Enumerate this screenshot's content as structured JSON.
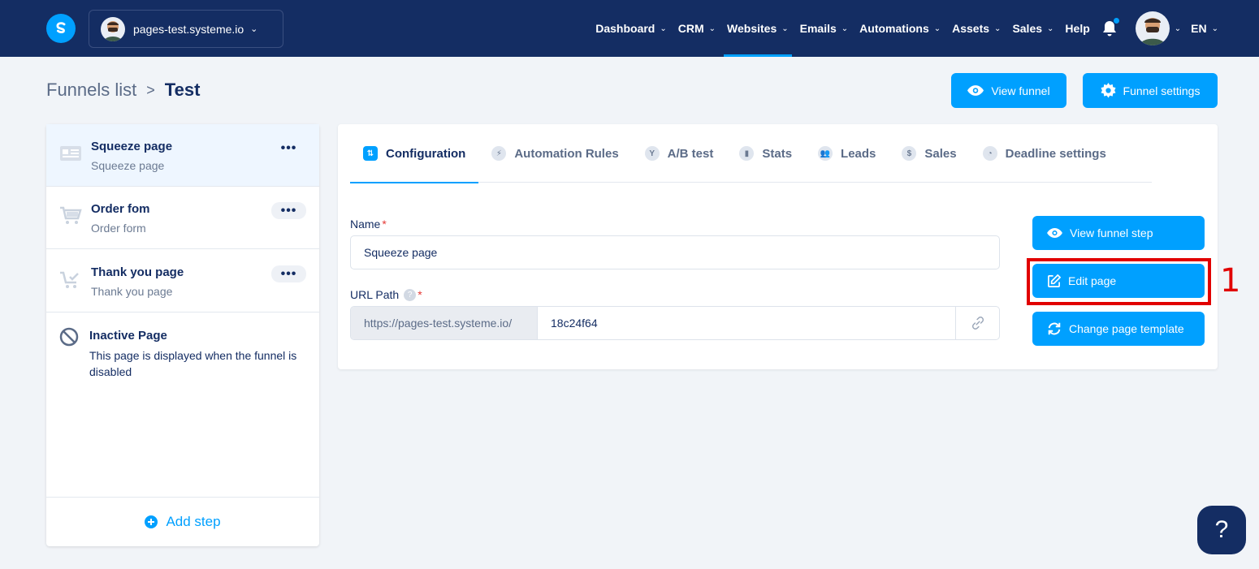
{
  "header": {
    "site_name": "pages-test.systeme.io",
    "nav": [
      {
        "label": "Dashboard",
        "dropdown": true
      },
      {
        "label": "CRM",
        "dropdown": true
      },
      {
        "label": "Websites",
        "dropdown": true,
        "active": true
      },
      {
        "label": "Emails",
        "dropdown": true
      },
      {
        "label": "Automations",
        "dropdown": true
      },
      {
        "label": "Assets",
        "dropdown": true
      },
      {
        "label": "Sales",
        "dropdown": true
      },
      {
        "label": "Help",
        "dropdown": false
      }
    ],
    "language": "EN",
    "chevron": "⌄"
  },
  "breadcrumb": {
    "parent": "Funnels list",
    "separator": ">",
    "current": "Test"
  },
  "top_actions": {
    "view_funnel": "View funnel",
    "funnel_settings": "Funnel settings"
  },
  "sidebar": {
    "steps": [
      {
        "title": "Squeeze page",
        "subtitle": "Squeeze page",
        "icon": "squeeze-page-icon",
        "active": true
      },
      {
        "title": "Order fom",
        "subtitle": "Order form",
        "icon": "cart-icon",
        "active": false
      },
      {
        "title": "Thank you page",
        "subtitle": "Thank you page",
        "icon": "cart-check-icon",
        "active": false
      }
    ],
    "menu_glyph": "•••",
    "inactive": {
      "title": "Inactive Page",
      "description": "This page is displayed when the funnel is disabled"
    },
    "add_step": "Add step"
  },
  "tabs": [
    {
      "label": "Configuration",
      "glyph": "⇅",
      "active": true
    },
    {
      "label": "Automation Rules",
      "glyph": "⚡"
    },
    {
      "label": "A/B test",
      "glyph": "Y"
    },
    {
      "label": "Stats",
      "glyph": "▮"
    },
    {
      "label": "Leads",
      "glyph": "👥"
    },
    {
      "label": "Sales",
      "glyph": "$"
    },
    {
      "label": "Deadline settings",
      "glyph": "◔"
    }
  ],
  "form": {
    "name_label": "Name",
    "name_value": "Squeeze page",
    "url_label": "URL Path",
    "url_prefix": "https://pages-test.systeme.io/",
    "url_path": "18c24f64",
    "required_mark": "*",
    "help_glyph": "?"
  },
  "step_actions": {
    "view_step": "View funnel step",
    "edit_page": "Edit page",
    "change_template": "Change page template"
  },
  "annotation": {
    "number": "1",
    "color": "#e10000"
  },
  "help_fab": "?",
  "colors": {
    "navy": "#142d63",
    "accent": "#00a0ff",
    "background": "#f1f4f8"
  }
}
